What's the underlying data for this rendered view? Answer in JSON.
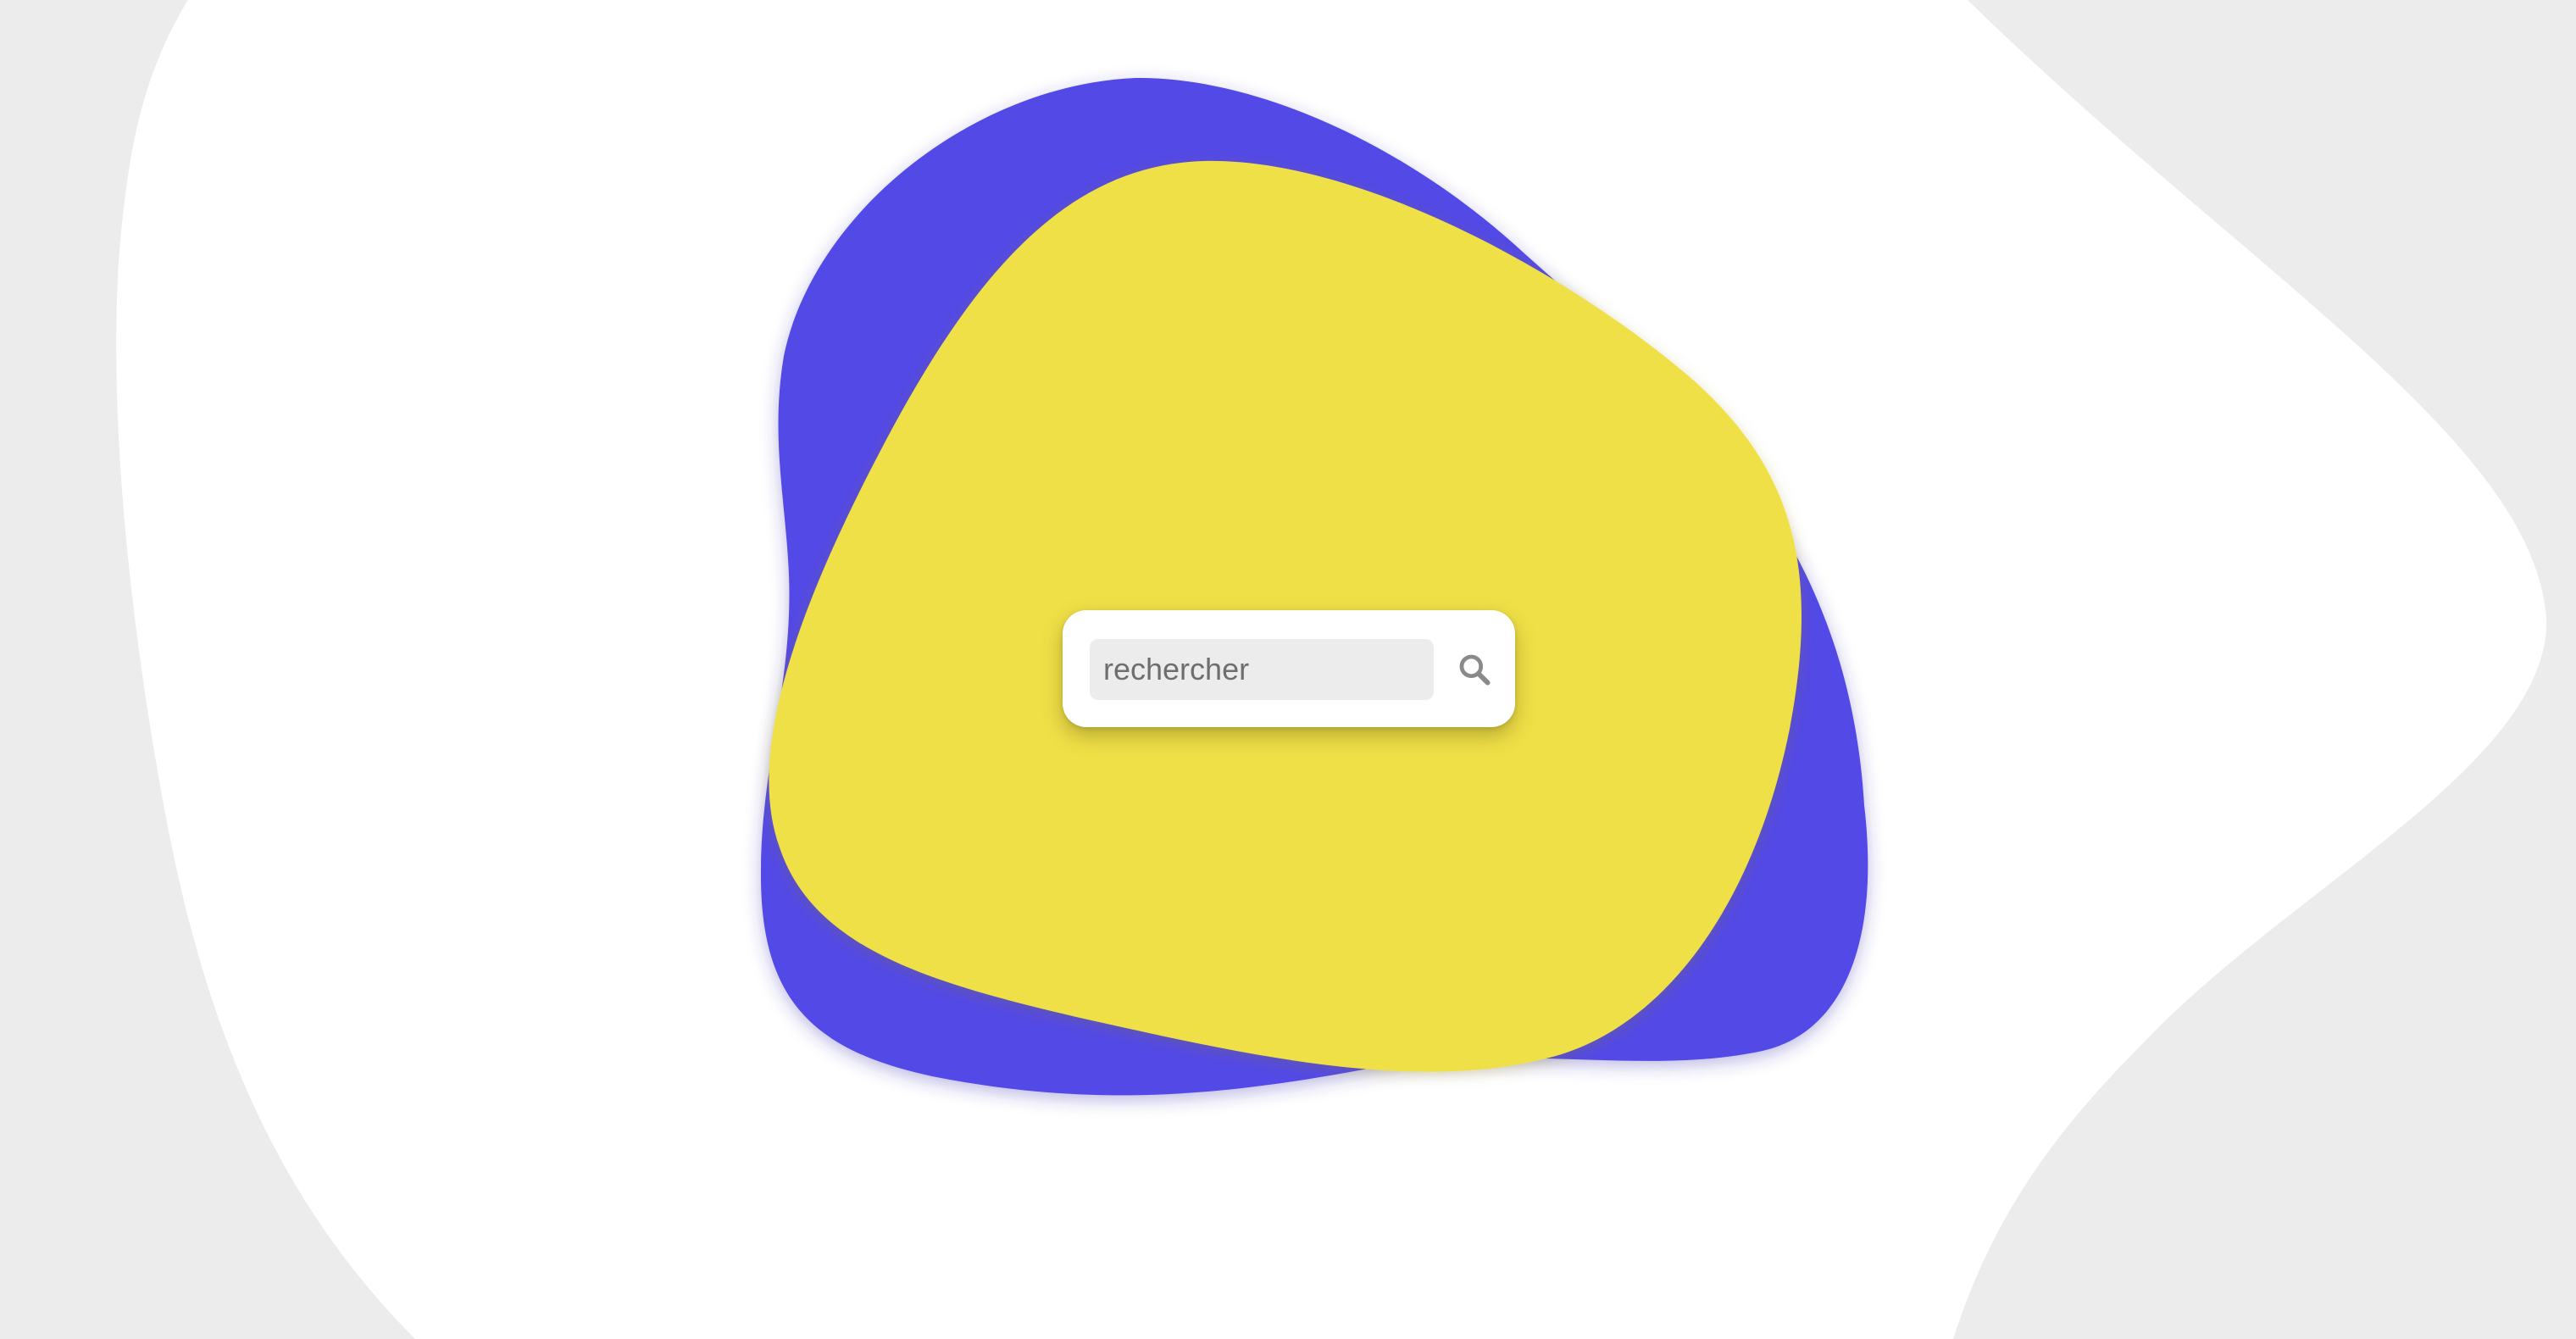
{
  "colors": {
    "page_background": "#ececec",
    "white_shape": "#ffffff",
    "blue_shape": "#534ae6",
    "yellow_shape": "#f0e046",
    "card_background": "#ffffff",
    "input_background": "#ececec",
    "icon_color": "#8a8a8a"
  },
  "search": {
    "placeholder": "rechercher",
    "value": "",
    "button_icon": "search-icon"
  }
}
